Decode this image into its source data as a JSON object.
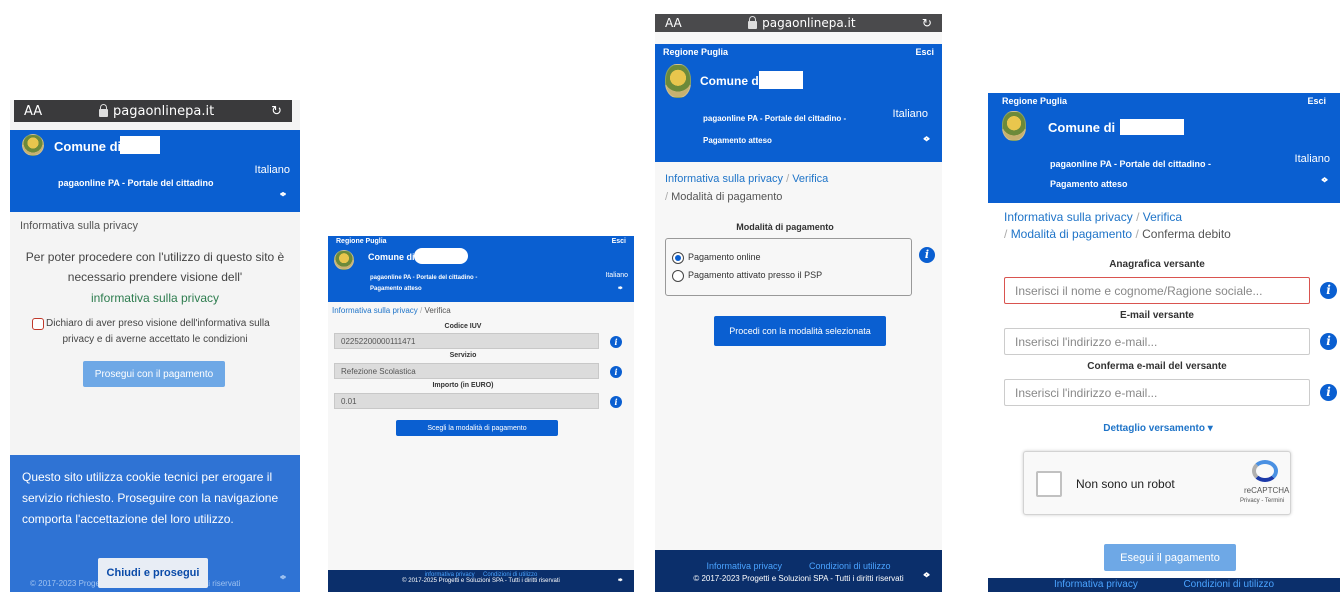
{
  "browser": {
    "aa_label": "AA",
    "url": "pagaonlinepa.it",
    "reload_icon": "reload-icon"
  },
  "brand": {
    "region": "Regione Puglia",
    "exit": "Esci",
    "municipality": "Comune di",
    "portal_title": "pagaonline PA - Portale del cittadino",
    "portal_title_dash": "pagaonline PA - Portale del cittadino -",
    "pending": "Pagamento atteso",
    "language": "Italiano"
  },
  "screen1": {
    "breadcrumb": "Informativa sulla privacy",
    "intro_line1": "Per poter procedere con l'utilizzo di questo sito è",
    "intro_line2": "necessario prendere visione dell'",
    "privacy_link": "informativa sulla privacy",
    "declare_line1": "Dichiaro di aver preso visione dell'informativa sulla",
    "declare_line2": "privacy e di averne accettato le condizioni",
    "proceed_button": "Prosegui con il pagamento",
    "cookie_text": "Questo sito utilizza cookie tecnici per erogare il servizio richiesto. Proseguire con la navigazione comporta l'accettazione del loro utilizzo.",
    "cookie_button": "Chiudi e prosegui",
    "footer_line": "© 2017-2023 Progetti e Soluzioni SPA - Tutti i diritti riservati"
  },
  "screen2": {
    "crumb1": "Informativa sulla privacy",
    "crumb2": "Verifica",
    "iuv_label": "Codice IUV",
    "iuv_value": "02252200000111471",
    "service_label": "Servizio",
    "service_value": "Refezione Scolastica",
    "amount_label": "Importo (in EURO)",
    "amount_value": "0.01",
    "choose_button": "Scegli la modalità di pagamento",
    "footer_links": "informativa privacy     Condizioni di utilizzo",
    "footer_line": "© 2017-2025 Progetti e Soluzioni SPA - Tutti i diritti riservati"
  },
  "screen3": {
    "crumb1": "Informativa sulla privacy",
    "crumb2": "Verifica",
    "crumb3": "Modalità di pagamento",
    "mode_title": "Modalità di pagamento",
    "option_online": "Pagamento online",
    "option_psp": "Pagamento attivato presso il PSP",
    "proceed_button": "Procedi con la modalità selezionata",
    "footer_privacy": "Informativa privacy",
    "footer_terms": "Condizioni di utilizzo",
    "footer_line": "© 2017-2023 Progetti e Soluzioni SPA - Tutti i diritti riservati"
  },
  "screen4": {
    "crumb1": "Informativa sulla privacy",
    "crumb2": "Verifica",
    "crumb3": "Modalità di pagamento",
    "crumb4": "Conferma debito",
    "payer_label": "Anagrafica versante",
    "payer_placeholder": "Inserisci il nome e cognome/Ragione sociale...",
    "email_label": "E-mail versante",
    "email_placeholder": "Inserisci l'indirizzo e-mail...",
    "email_confirm_label": "Conferma e-mail del versante",
    "email_confirm_placeholder": "Inserisci l'indirizzo e-mail...",
    "detail_toggle": "Dettaglio versamento",
    "captcha_label": "Non sono un robot",
    "captcha_brand": "reCAPTCHA",
    "captcha_links": "Privacy - Termini",
    "pay_button": "Esegui il pagamento",
    "footer_privacy": "Informativa privacy",
    "footer_terms": "Condizioni di utilizzo"
  },
  "colors": {
    "primary": "#0a5fd1",
    "footer": "#0b2f6b",
    "error_border": "#d9534f"
  }
}
